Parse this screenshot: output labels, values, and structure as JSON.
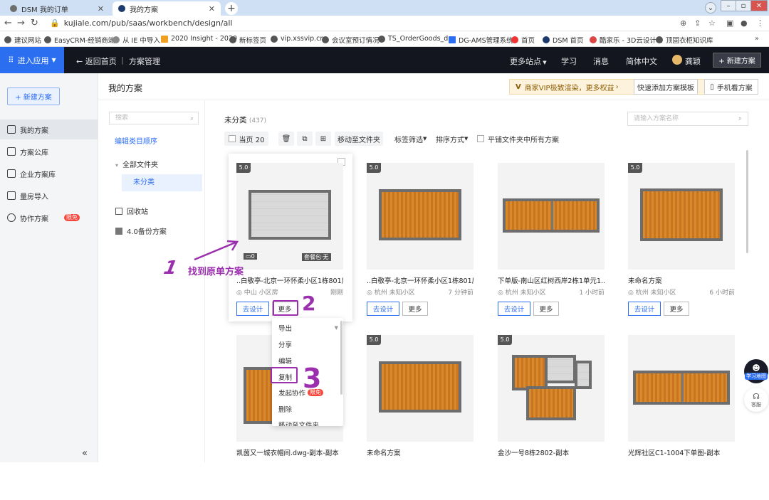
{
  "tabs": [
    {
      "title": "DSM 我的订单"
    },
    {
      "title": "我的方案"
    }
  ],
  "url": "kujiale.com/pub/saas/workbench/design/all",
  "bookmarks": [
    "建议网站",
    "EasyCRM-经销商端",
    "从 IE 中导入",
    "2020 Insight - 2020",
    "新标签页",
    "vip.xssvip.cn",
    "会议室预订情况",
    "TS_OrderGoods_d...",
    "DG-AMS管理系统",
    "首页",
    "DSM 首页",
    "酷家乐 - 3D云设计...",
    "顶固衣柜知识库"
  ],
  "header": {
    "enter_app": "进入应用",
    "back_home": "← 返回首页",
    "section": "方案管理",
    "more_sites": "更多站点",
    "learn": "学习",
    "messages": "消息",
    "language": "简体中文",
    "user": "龚颖",
    "new_plan": "+ 新建方案"
  },
  "sidebar": {
    "new_plan": "+ 新建方案",
    "items": [
      "我的方案",
      "方案公库",
      "企业方案库",
      "量房导入",
      "协作方案"
    ],
    "limited_badge": "限免"
  },
  "titlebar": {
    "title": "我的方案",
    "vip_banner": "商家VIP极致渲染，更多权益",
    "quick_template": "快速添加方案模板",
    "mobile_view": "手机看方案"
  },
  "folders": {
    "search_placeholder": "搜索",
    "sort_link": "编辑类目顺序",
    "all": "全部文件夹",
    "unsorted": "未分类",
    "recycle": "回收站",
    "backup": "4.0备份方案"
  },
  "main": {
    "category": "未分类",
    "count": "(437)",
    "search_placeholder": "请输入方案名称",
    "toolbar": {
      "current_page": "当页 20",
      "move_to_folder": "移动至文件夹",
      "tag_filter": "标签筛选",
      "sort": "排序方式",
      "show_all": "平铺文件夹中所有方案"
    },
    "design_btn": "去设计",
    "more_btn": "更多",
    "cards": [
      {
        "version": "5.0",
        "title": "..白敬亭-北京一环怀柔小区1栋801房",
        "location": "中山 小区房",
        "time": "刚刚",
        "counter": "0",
        "package": "套餐包·无"
      },
      {
        "version": "5.0",
        "title": "..白敬亭-北京一环怀柔小区1栋801房",
        "location": "杭州 未知小区",
        "time": "7 分钟前"
      },
      {
        "version": "",
        "title": "下单版-南山区红树西岸2栋1单元1...",
        "location": "杭州 未知小区",
        "time": "1 小时前"
      },
      {
        "version": "5.0",
        "title": "未命名方案",
        "location": "杭州 未知小区",
        "time": "6 小时前"
      },
      {
        "version": "",
        "title": "凯茵又一城衣帽间.dwg-副本-副本"
      },
      {
        "version": "5.0",
        "title": "未命名方案"
      },
      {
        "version": "5.0",
        "title": "金沙一号8栋2802-副本"
      },
      {
        "version": "",
        "title": "光辉社区C1-1004下单图-副本"
      }
    ]
  },
  "dropdown": {
    "items": [
      "导出",
      "分享",
      "编辑",
      "复制",
      "发起协作",
      "删除",
      "移动至文件夹"
    ],
    "limited_badge": "限免"
  },
  "annotations": {
    "step1_num": "1",
    "step1_text": "找到原单方案",
    "step2_num": "2",
    "step3_num": "3",
    "color": "#9b2fae"
  },
  "float": {
    "learn_map": "学习地图",
    "service": "客服"
  }
}
